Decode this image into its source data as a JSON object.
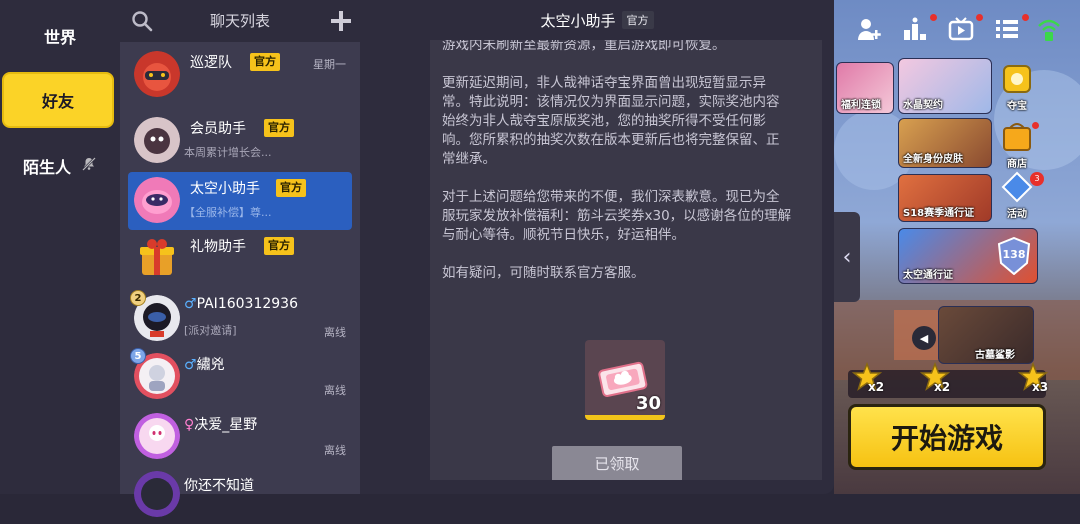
{
  "categories": [
    {
      "label": "世界"
    },
    {
      "label": "好友",
      "active": true
    },
    {
      "label": "陌生人"
    }
  ],
  "list_header": {
    "title": "聊天列表"
  },
  "chats": [
    {
      "name": "巡逻队",
      "badge": "官方",
      "time": "星期一",
      "preview": ""
    },
    {
      "name": "会员助手",
      "badge": "官方",
      "time": "",
      "preview": "本周累计增长会..."
    },
    {
      "name": "太空小助手",
      "badge": "官方",
      "time": "",
      "preview": "【全服补偿】尊..."
    },
    {
      "name": "礼物助手",
      "badge": "官方",
      "time": "",
      "preview": ""
    },
    {
      "name": "PAI160312936",
      "gender": "♂",
      "level": "2",
      "preview": "[派对邀请]",
      "status": "离线"
    },
    {
      "name": "繡兇",
      "gender": "♂",
      "level": "5",
      "preview": "",
      "status": "离线"
    },
    {
      "name": "决爱_星野",
      "gender": "♀",
      "preview": "",
      "status": "离线"
    },
    {
      "name": "你还不知道",
      "gender": "",
      "preview": "",
      "status": ""
    }
  ],
  "chat_panel": {
    "title": "太空小助手",
    "badge": "官方",
    "paragraphs": [
      "游戏内未刷新至最新资源，重启游戏即可恢复。",
      "更新延迟期间，非人哉神话夺宝界面曾出现短暂显示异常。特此说明：该情况仅为界面显示问题，实际奖池内容始终为非人哉夺宝原版奖池，您的抽奖所得不受任何影响。您所累积的抽奖次数在版本更新后也将完整保留、正常继承。",
      "对于上述问题给您带来的不便，我们深表歉意。现已为全服玩家发放补偿福利：筋斗云奖券x30，以感谢各位的理解与耐心等待。顺祝节日快乐，好运相伴。",
      "如有疑问，可随时联系官方客服。"
    ],
    "reward_count": "30",
    "claimed_label": "已领取"
  },
  "game": {
    "tiles": [
      {
        "label": "福利连锁"
      },
      {
        "label": "水晶契约"
      },
      {
        "label": "全新身份皮肤"
      },
      {
        "label": "S18赛季通行证"
      },
      {
        "label": "太空通行证"
      },
      {
        "label": "古墓鲨影"
      }
    ],
    "side_buttons": [
      {
        "label": "夺宝"
      },
      {
        "label": "商店"
      },
      {
        "label": "活动",
        "badge": "3"
      }
    ],
    "pass_level": "138",
    "stars": [
      "x2",
      "x2",
      "x3"
    ],
    "start_label": "开始游戏"
  },
  "colors": {
    "accent": "#fbd327",
    "active_chat": "#2b5fbf",
    "official_badge": "#f6c21b"
  }
}
